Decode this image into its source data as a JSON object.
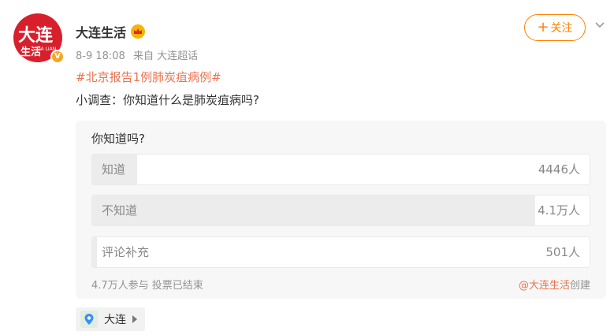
{
  "avatar": {
    "line1": "大连",
    "line2": "生活",
    "tiny": "DA LIAN",
    "badge": "V"
  },
  "account": {
    "name": "大连生活",
    "crown_icon": "crown-icon"
  },
  "post": {
    "time": "8-9 18:08",
    "source": "来自 大连超话",
    "hashtag": "#北京报告1例肺炭疽病例#",
    "text": "小调查：你知道什么是肺炭疽病吗?"
  },
  "follow": {
    "label": "关注",
    "plus": "+"
  },
  "poll": {
    "question": "你知道吗?",
    "options": [
      {
        "label": "知道",
        "count": "4446人",
        "fraction": 0.09
      },
      {
        "label": "不知道",
        "count": "4.1万人",
        "fraction": 0.89
      },
      {
        "label": "评论补充",
        "count": "501人",
        "fraction": 0.01
      }
    ],
    "summary": "4.7万人参与 投票已结束",
    "creator": "@大连生活",
    "created_suffix": "创建"
  },
  "location": {
    "name": "大连",
    "icon": "location-pin-icon"
  },
  "colors": {
    "accent": "#ff8200",
    "link": "#eb7350",
    "avatar_bg": "#d8202d"
  }
}
